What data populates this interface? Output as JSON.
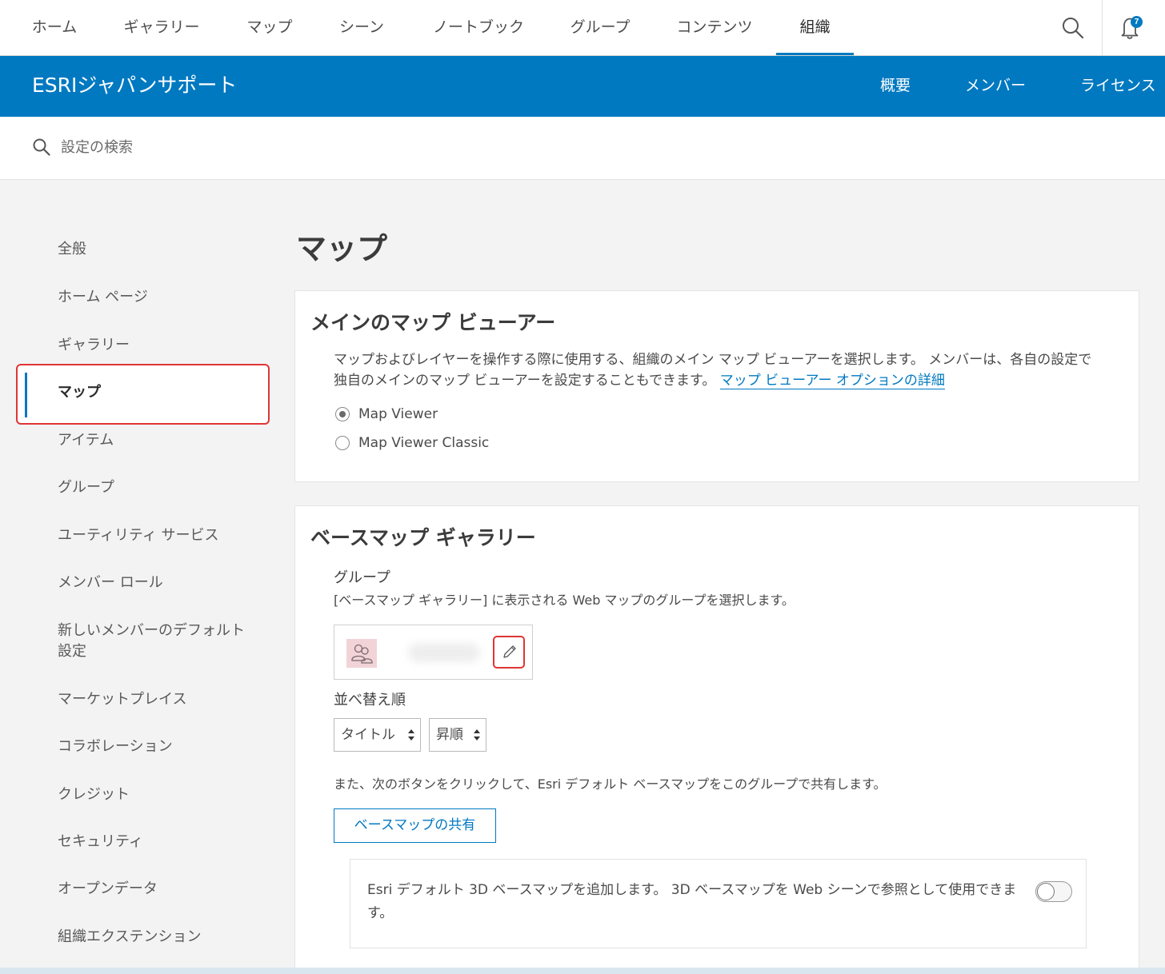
{
  "topnav": {
    "tabs": [
      {
        "label": "ホーム"
      },
      {
        "label": "ギャラリー"
      },
      {
        "label": "マップ"
      },
      {
        "label": "シーン"
      },
      {
        "label": "ノートブック"
      },
      {
        "label": "グループ"
      },
      {
        "label": "コンテンツ"
      },
      {
        "label": "組織",
        "active": true
      }
    ],
    "notification_count": "7"
  },
  "orgbar": {
    "title": "ESRIジャパンサポート",
    "tabs": [
      {
        "label": "概要"
      },
      {
        "label": "メンバー"
      },
      {
        "label": "ライセンス"
      }
    ]
  },
  "settings_search": {
    "placeholder": "設定の検索"
  },
  "sidebar": {
    "items": [
      {
        "label": "全般"
      },
      {
        "label": "ホーム ページ"
      },
      {
        "label": "ギャラリー"
      },
      {
        "label": "マップ",
        "active": true
      },
      {
        "label": "アイテム"
      },
      {
        "label": "グループ"
      },
      {
        "label": "ユーティリティ サービス"
      },
      {
        "label": "メンバー ロール"
      },
      {
        "label": "新しいメンバーのデフォルト設定"
      },
      {
        "label": "マーケットプレイス"
      },
      {
        "label": "コラボレーション"
      },
      {
        "label": "クレジット"
      },
      {
        "label": "セキュリティ"
      },
      {
        "label": "オープンデータ"
      },
      {
        "label": "組織エクステンション"
      }
    ]
  },
  "main": {
    "page_title": "マップ",
    "viewer_card": {
      "heading": "メインのマップ ビューアー",
      "description": "マップおよびレイヤーを操作する際に使用する、組織のメイン マップ ビューアーを選択します。 メンバーは、各自の設定で独自のメインのマップ ビューアーを設定することもできます。",
      "link": "マップ ビューアー オプションの詳細",
      "options": [
        {
          "label": "Map Viewer",
          "checked": true
        },
        {
          "label": "Map Viewer Classic",
          "checked": false
        }
      ]
    },
    "basemap_card": {
      "heading": "ベースマップ ギャラリー",
      "group_label": "グループ",
      "group_desc": "[ベースマップ ギャラリー] に表示される Web マップのグループを選択します。",
      "sort_label": "並べ替え順",
      "sort_field": "タイトル",
      "sort_order": "昇順",
      "share_desc": "また、次のボタンをクリックして、Esri デフォルト ベースマップをこのグループで共有します。",
      "share_button": "ベースマップの共有",
      "toggle_text": "Esri デフォルト 3D ベースマップを追加します。 3D ベースマップを Web シーンで参照として使用できます。",
      "toggle_on": false
    }
  },
  "colors": {
    "accent": "#0079c1",
    "highlight": "#e03535"
  }
}
